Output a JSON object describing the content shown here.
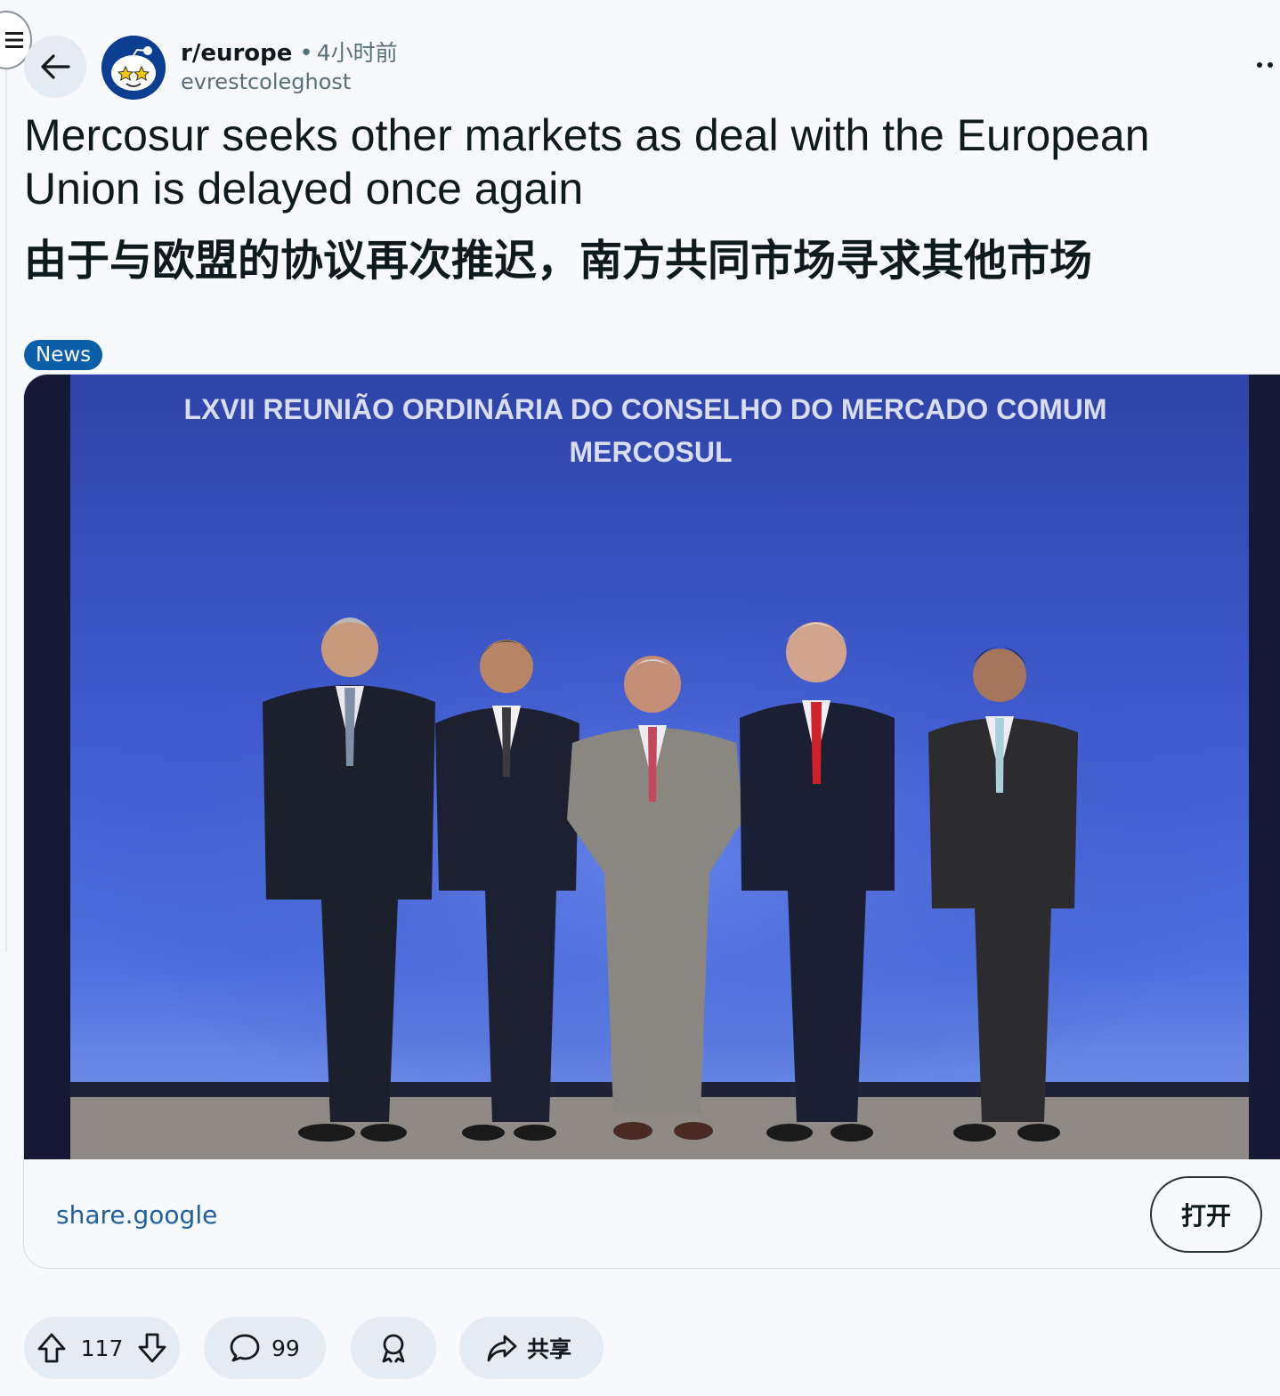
{
  "post": {
    "subreddit": "r/europe",
    "separator": "•",
    "time_ago": "4小时前",
    "author": "evrestcoleghost",
    "title": "Mercosur seeks other markets as deal with the European Union is delayed once again",
    "title_translation": "由于与欧盟的协议再次推迟，南方共同市场寻求其他市场",
    "flair": "News",
    "flair_color": "#0a5fa8"
  },
  "link": {
    "image_banner_line1": "LXVII REUNIÃO ORDINÁRIA DO CONSELHO DO MERCADO COMUM",
    "image_banner_line2": "MERCOSUL",
    "domain": "share.google",
    "open_label": "打开"
  },
  "actions": {
    "vote_count": "117",
    "comment_count": "99",
    "share_label": "共享"
  },
  "icons": {
    "menu": "menu-icon",
    "back": "arrow-left-icon",
    "more": "more-horizontal-icon",
    "upvote": "upvote-icon",
    "downvote": "downvote-icon",
    "comment": "comment-icon",
    "award": "award-icon",
    "share": "share-icon"
  }
}
